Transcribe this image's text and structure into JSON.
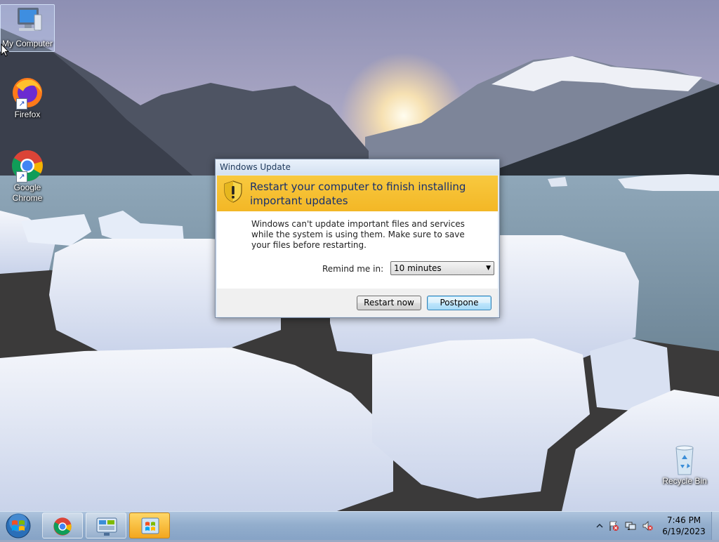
{
  "desktop": {
    "icons": [
      {
        "label": "My Computer",
        "icon": "computer-icon"
      },
      {
        "label": "Firefox",
        "icon": "firefox-icon"
      },
      {
        "label": "Google\nChrome",
        "icon": "chrome-icon"
      },
      {
        "label": "Recycle Bin",
        "icon": "recycle-bin-icon"
      }
    ]
  },
  "dialog": {
    "window_title": "Windows Update",
    "header_title": "Restart your computer to finish installing important updates",
    "message": "Windows can't update important files and services while the system is using them. Make sure to save your files before restarting.",
    "remind_label": "Remind me in:",
    "remind_value": "10 minutes",
    "restart_label": "Restart now",
    "postpone_label": "Postpone",
    "header_color": "#f6be2e",
    "icon": "shield-warning-icon"
  },
  "taskbar": {
    "items": [
      {
        "name": "start-orb",
        "icon": "windows-logo-icon"
      },
      {
        "name": "chrome",
        "icon": "chrome-icon"
      },
      {
        "name": "control-panel",
        "icon": "control-panel-icon"
      },
      {
        "name": "windows-update",
        "icon": "windows-update-icon"
      }
    ],
    "tray_icons": [
      "show-hidden-icons-chevron-icon",
      "action-center-flag-icon",
      "network-icon",
      "volume-muted-icon"
    ],
    "time": "7:46 PM",
    "date": "6/19/2023"
  }
}
